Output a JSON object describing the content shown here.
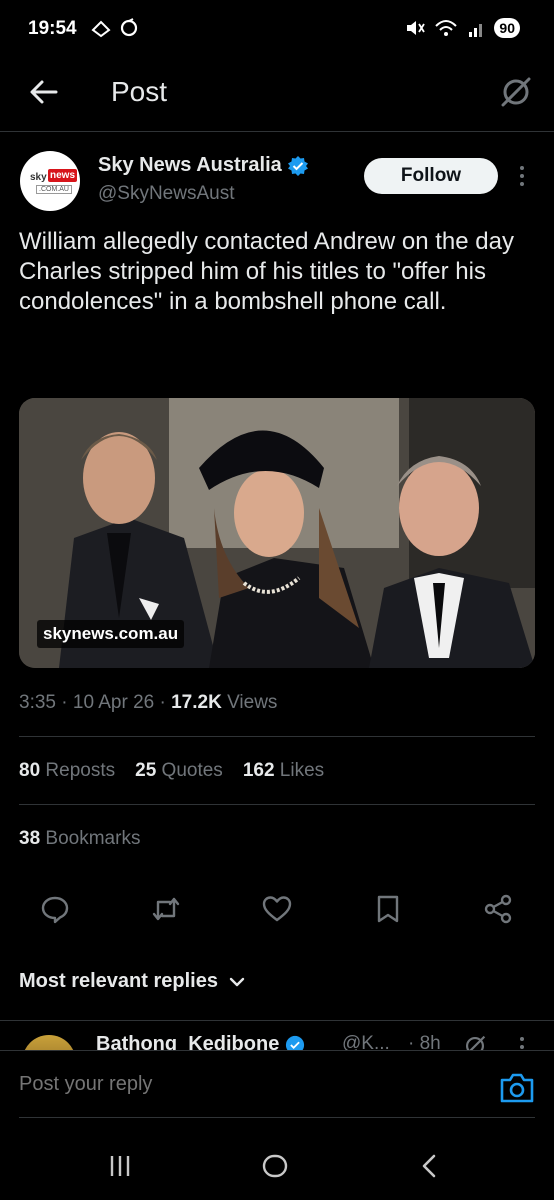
{
  "status_bar": {
    "time": "19:54",
    "battery": "90"
  },
  "header": {
    "title": "Post"
  },
  "author": {
    "name": "Sky News Australia",
    "handle": "@SkyNewsAust",
    "avatar_text_sky": "sky",
    "avatar_text_news": "news",
    "avatar_text_domain": ".COM.AU",
    "follow_label": "Follow"
  },
  "tweet": {
    "text": "William allegedly contacted Andrew on the day Charles stripped him of his titles to \"offer his condolences\" in a bombshell phone call.",
    "media_caption": "skynews.com.au"
  },
  "meta": {
    "time": "3:35",
    "date": "10 Apr 26",
    "views_count": "17.2K",
    "views_label": "Views"
  },
  "stats": {
    "reposts_count": "80",
    "reposts_label": "Reposts",
    "quotes_count": "25",
    "quotes_label": "Quotes",
    "likes_count": "162",
    "likes_label": "Likes",
    "bookmarks_count": "38",
    "bookmarks_label": "Bookmarks"
  },
  "actions": [
    "reply-icon",
    "repost-icon",
    "like-icon",
    "bookmark-icon",
    "share-icon"
  ],
  "replies": {
    "sort_label": "Most relevant replies"
  },
  "reply_peek": {
    "name": "Bathong_Kedibone",
    "handle": "@K...",
    "time": "· 8h"
  },
  "reply_box": {
    "placeholder": "Post your reply"
  },
  "colors": {
    "background": "#000000",
    "accent": "#1d9bf0",
    "muted": "#71767b",
    "text": "#e7e9ea"
  }
}
